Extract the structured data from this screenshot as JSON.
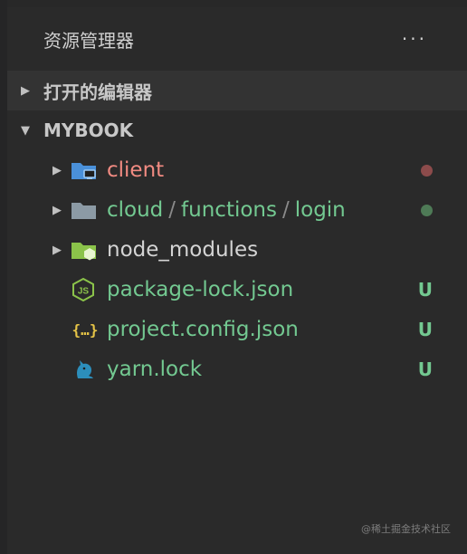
{
  "colors": {
    "modified": "#f28b82",
    "untracked": "#73c991",
    "modified_dot": "#8c4b4b",
    "untracked_dot": "#4e7a56",
    "folder_blue": "#4a90d9",
    "folder_gray": "#8c9aa5",
    "folder_green": "#8bc34a",
    "js_green": "#8bc34a",
    "json_yellow": "#e7c547",
    "yarn_blue": "#2c8ebb"
  },
  "explorer": {
    "title": "资源管理器",
    "more_label": "···",
    "open_editors_label": "打开的编辑器",
    "project_label": "MYBOOK",
    "items": [
      {
        "name": "client",
        "expandable": true,
        "icon": "folder-blue-icon",
        "color": "modified",
        "status": "dot"
      },
      {
        "name_parts": [
          "cloud",
          "functions",
          "login"
        ],
        "separator": "/",
        "expandable": true,
        "icon": "folder-gray-icon",
        "color": "untracked",
        "status": "dot"
      },
      {
        "name": "node_modules",
        "expandable": true,
        "icon": "folder-node-icon",
        "color": "plain",
        "status": ""
      },
      {
        "name": "package-lock.json",
        "expandable": false,
        "icon": "nodejs-icon",
        "color": "untracked",
        "status": "U"
      },
      {
        "name": "project.config.json",
        "expandable": false,
        "icon": "json-icon",
        "color": "untracked",
        "status": "U"
      },
      {
        "name": "yarn.lock",
        "expandable": false,
        "icon": "yarn-icon",
        "color": "untracked",
        "status": "U"
      }
    ]
  },
  "watermark": "@稀土掘金技术社区"
}
